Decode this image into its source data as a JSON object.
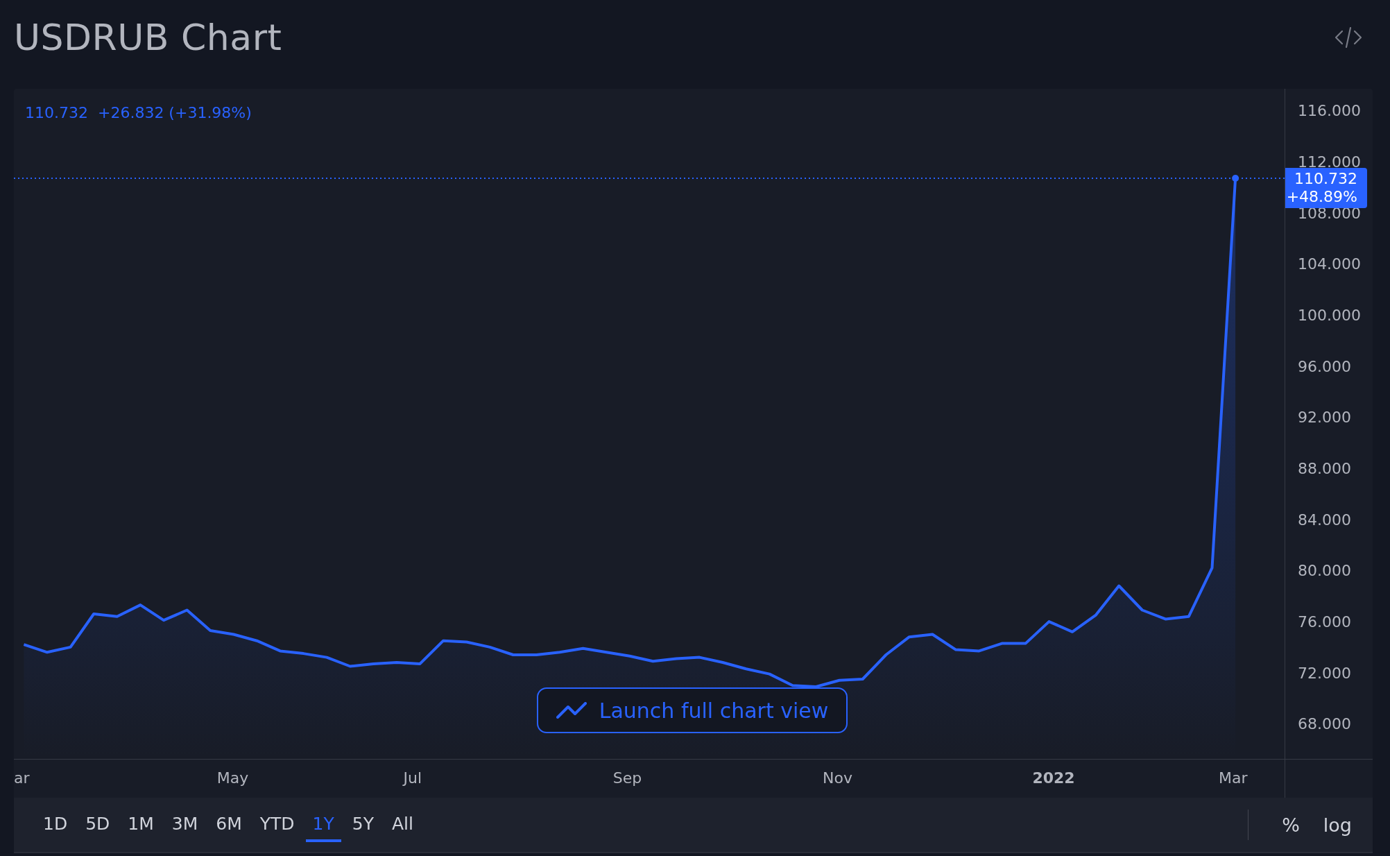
{
  "title": "USDRUB Chart",
  "legend": "110.732  +26.832 (+31.98%)",
  "last_price": {
    "price": "110.732",
    "change": "+48.89%"
  },
  "chart_data": {
    "type": "area",
    "categories": [
      "ar",
      null,
      null,
      null,
      null,
      null,
      null,
      null,
      null,
      "May",
      null,
      null,
      null,
      null,
      null,
      null,
      null,
      "Jul",
      null,
      null,
      null,
      null,
      null,
      null,
      null,
      null,
      "Sep",
      null,
      null,
      null,
      null,
      null,
      null,
      null,
      null,
      "Nov",
      null,
      null,
      null,
      null,
      null,
      null,
      null,
      null,
      "2022",
      null,
      null,
      null,
      null,
      null,
      null,
      null,
      "Mar"
    ],
    "series": [
      {
        "color": "#2962ff",
        "values": [
          74.2,
          73.6,
          74.0,
          76.6,
          76.4,
          77.3,
          76.1,
          76.9,
          75.3,
          75.0,
          74.5,
          73.7,
          73.5,
          73.2,
          72.5,
          72.7,
          72.8,
          72.7,
          74.5,
          74.4,
          74.0,
          73.4,
          73.4,
          73.6,
          73.9,
          73.6,
          73.3,
          72.9,
          73.1,
          73.2,
          72.8,
          72.3,
          71.9,
          71.0,
          70.9,
          71.4,
          71.5,
          73.4,
          74.8,
          75.0,
          73.8,
          73.7,
          74.3,
          74.3,
          76.0,
          75.2,
          76.5,
          78.8,
          76.9,
          76.2,
          76.4,
          80.2,
          110.7
        ]
      }
    ],
    "ylim": [
      65.2,
      117.7
    ],
    "ref_lines": [
      {
        "axis": "y",
        "value": 110.7
      }
    ],
    "yticks": [
      {
        "value": 68,
        "label": "68.000"
      },
      {
        "value": 72,
        "label": "72.000"
      },
      {
        "value": 76,
        "label": "76.000"
      },
      {
        "value": 80,
        "label": "80.000"
      },
      {
        "value": 84,
        "label": "84.000"
      },
      {
        "value": 88,
        "label": "88.000"
      },
      {
        "value": 92,
        "label": "92.000"
      },
      {
        "value": 96,
        "label": "96.000"
      },
      {
        "value": 100,
        "label": "100.000"
      },
      {
        "value": 104,
        "label": "104.000"
      },
      {
        "value": 108,
        "label": "108.000"
      },
      {
        "value": 112,
        "label": "112.000"
      },
      {
        "value": 116,
        "label": "116.000"
      }
    ]
  },
  "launch_button": "Launch full chart view",
  "ranges": [
    {
      "label": "1D",
      "selected": false
    },
    {
      "label": "5D",
      "selected": false
    },
    {
      "label": "1M",
      "selected": false
    },
    {
      "label": "3M",
      "selected": false
    },
    {
      "label": "6M",
      "selected": false
    },
    {
      "label": "YTD",
      "selected": false
    },
    {
      "label": "1Y",
      "selected": true
    },
    {
      "label": "5Y",
      "selected": false
    },
    {
      "label": "All",
      "selected": false
    }
  ],
  "scale_options": [
    "%",
    "log"
  ]
}
